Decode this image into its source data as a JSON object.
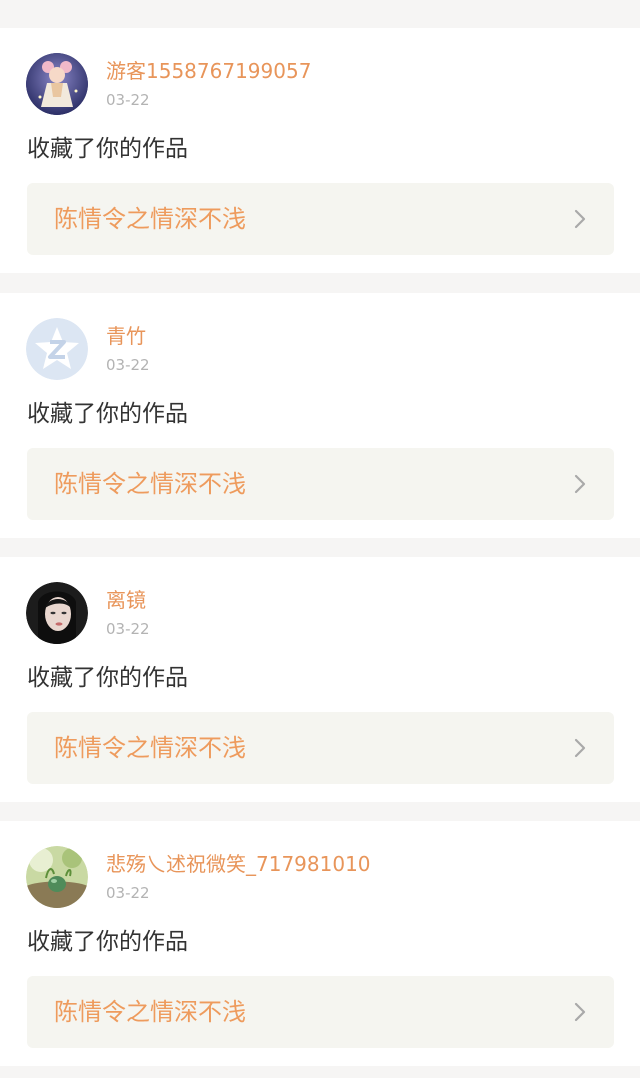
{
  "notifications": [
    {
      "avatar_icon": "anime-girl-avatar-icon",
      "username": "游客1558767199057",
      "date": "03-22",
      "action": "收藏了你的作品",
      "work_title": "陈情令之情深不浅"
    },
    {
      "avatar_icon": "default-z-avatar-icon",
      "username": "青竹",
      "date": "03-22",
      "action": "收藏了你的作品",
      "work_title": "陈情令之情深不浅"
    },
    {
      "avatar_icon": "portrait-photo-avatar-icon",
      "username": "离镜",
      "date": "03-22",
      "action": "收藏了你的作品",
      "work_title": "陈情令之情深不浅"
    },
    {
      "avatar_icon": "nature-photo-avatar-icon",
      "username": "悲殇乀述祝微笑_717981010",
      "date": "03-22",
      "action": "收藏了你的作品",
      "work_title": "陈情令之情深不浅"
    }
  ],
  "colors": {
    "username": "#e8955a",
    "work_title": "#ee9b5d",
    "date": "#b3b3b3",
    "action_text": "#333333",
    "work_bg": "#f5f5f0",
    "page_bg": "#f6f5f4"
  }
}
